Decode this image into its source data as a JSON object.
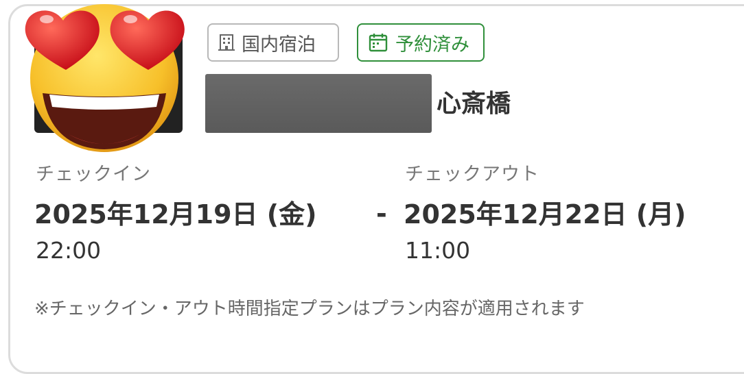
{
  "tags": {
    "domestic": {
      "label": "国内宿泊",
      "icon": "building-icon"
    },
    "reserved": {
      "label": "予約済み",
      "icon": "calendar-check-icon"
    }
  },
  "hotel": {
    "name_suffix": "心斎橋"
  },
  "checkin": {
    "label": "チェックイン",
    "date": "2025年12月19日 (金)",
    "time": "22:00"
  },
  "checkout": {
    "label": "チェックアウト",
    "date": "2025年12月22日 (月)",
    "time": "11:00"
  },
  "separator": "-",
  "note": "※チェックイン・アウト時間指定プランはプラン内容が適用されます",
  "colors": {
    "reserved_green": "#2f8f3a",
    "border_gray": "#dcdcdc",
    "text_dark": "#333333",
    "text_muted": "#777777"
  }
}
